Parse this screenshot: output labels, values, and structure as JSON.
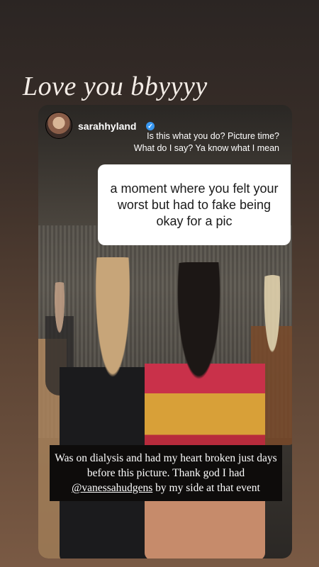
{
  "story": {
    "top_caption": "Love you bbyyyy"
  },
  "post": {
    "username": "sarahhyland",
    "verified_badge": "✓",
    "reply_lines": [
      "Is this what you do? Picture time?",
      "What do I say? Ya know what I mean"
    ],
    "question": "a moment where you felt your worst but had to fake being okay for a pic",
    "caption_before": "Was on dialysis and had my heart broken just days before this picture. Thank god I had ",
    "caption_mention": "@vanessahudgens",
    "caption_after": " by my side at that event"
  },
  "colors": {
    "verified": "#3897f0",
    "caption_bg": "#0e0c0b"
  }
}
